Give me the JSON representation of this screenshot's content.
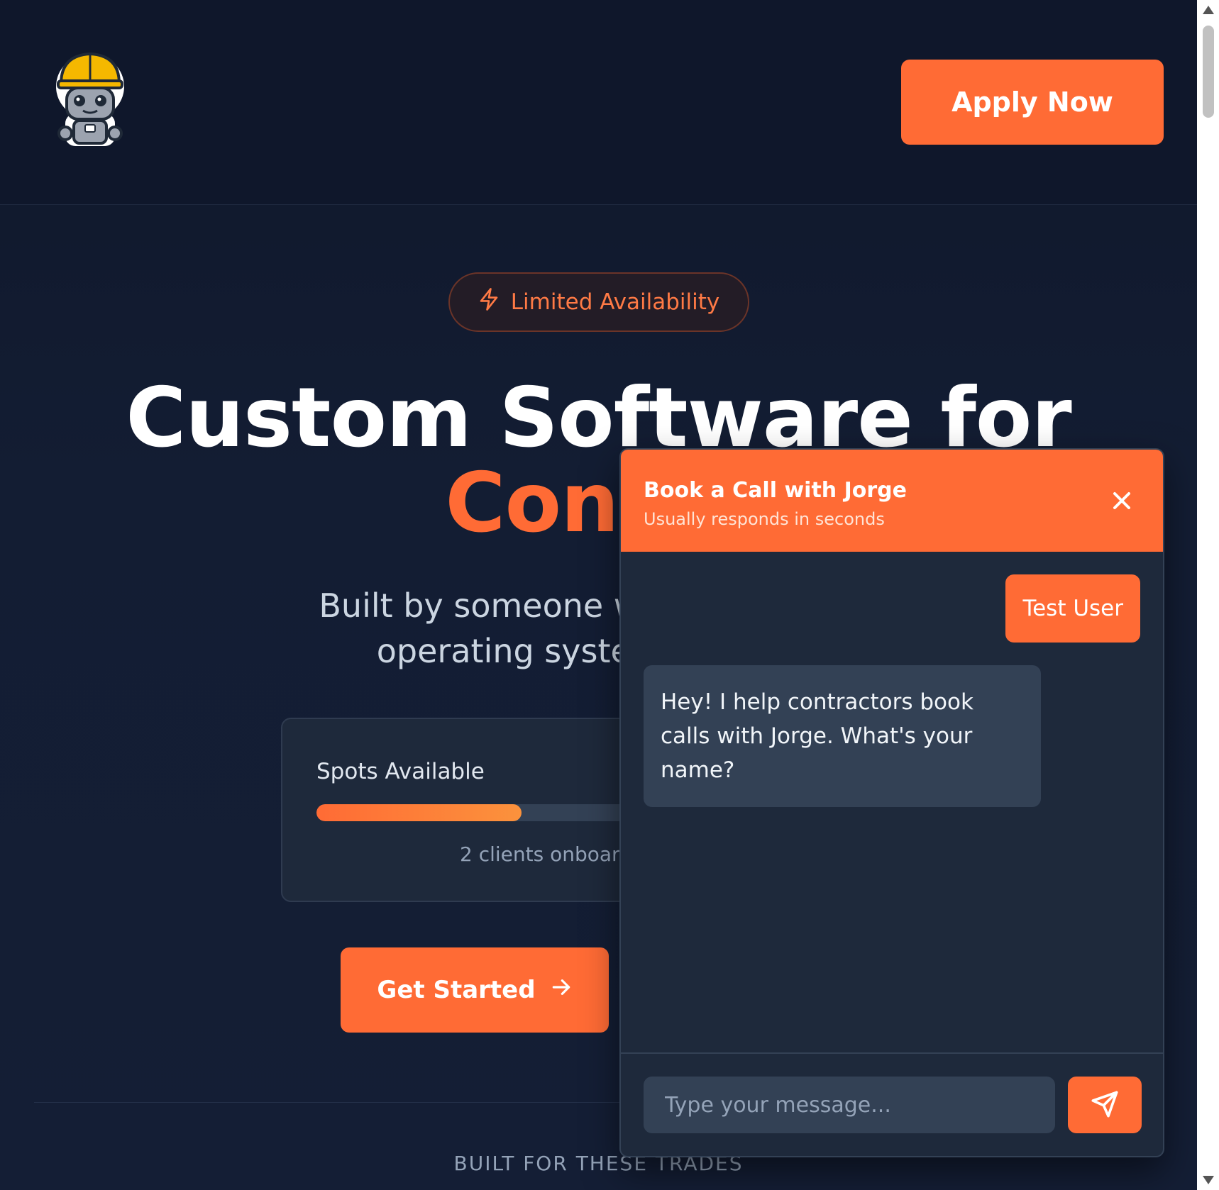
{
  "header": {
    "apply_label": "Apply Now"
  },
  "hero": {
    "badge_label": "Limited Availability",
    "title_line1": "Custom Software for",
    "title_line2": "Contra",
    "subtitle_line1": "Built by someone who understand",
    "subtitle_line2": "operating system tailored t"
  },
  "spots": {
    "title": "Spots Available",
    "progress_fraction": 0.36,
    "status_text": "2 clients onboarde"
  },
  "cta": {
    "get_started_label": "Get Started"
  },
  "trades": {
    "label": "BUILT FOR THESE TRADES"
  },
  "chat": {
    "title": "Book a Call with Jorge",
    "subtitle": "Usually responds in seconds",
    "messages": [
      {
        "from": "user",
        "text": "Test User"
      },
      {
        "from": "bot",
        "text": "Hey! I help contractors book calls with Jorge. What's your name?"
      }
    ],
    "input_placeholder": "Type your message..."
  },
  "colors": {
    "accent": "#ff6b35",
    "background": "#0f172a",
    "card": "#1e293b"
  },
  "icons": {
    "logo": "robot-hardhat-icon",
    "badge": "lightning-icon",
    "cta": "arrow-right-icon",
    "close": "close-icon",
    "send": "send-icon"
  }
}
